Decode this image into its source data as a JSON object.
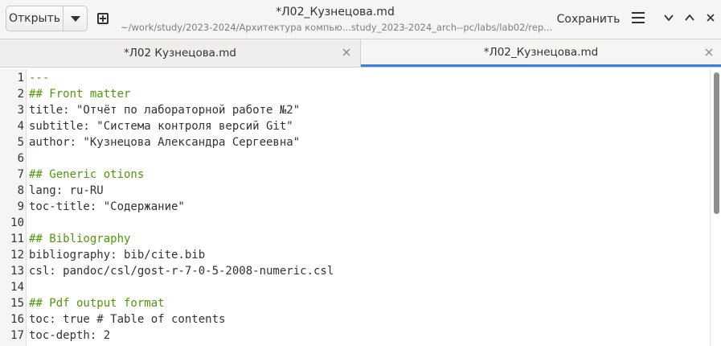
{
  "header": {
    "open_label": "Открыть",
    "title": "*Л02_Кузнецова.md",
    "subtitle": "~/work/study/2023-2024/Архитектура компью...study_2023-2024_arch--pc/labs/lab02/rep...",
    "save_label": "Сохранить"
  },
  "tabs": [
    {
      "label": "*Л02 Кузнецова.md",
      "active": false
    },
    {
      "label": "*Л02_Кузнецова.md",
      "active": true
    }
  ],
  "editor": {
    "lines": [
      {
        "n": "1",
        "text": "---",
        "kind": "dashes"
      },
      {
        "n": "2",
        "text": "## Front matter",
        "kind": "heading"
      },
      {
        "n": "3",
        "text": "title: \"Отчёт по лабораторной работе №2\"",
        "kind": "text"
      },
      {
        "n": "4",
        "text": "subtitle: \"Система контроля версий Git\"",
        "kind": "text"
      },
      {
        "n": "5",
        "text": "author: \"Кузнецова Александра Сергеевна\"",
        "kind": "text"
      },
      {
        "n": "6",
        "text": "",
        "kind": "text"
      },
      {
        "n": "7",
        "text": "## Generic otions",
        "kind": "heading"
      },
      {
        "n": "8",
        "text": "lang: ru-RU",
        "kind": "text"
      },
      {
        "n": "9",
        "text": "toc-title: \"Содержание\"",
        "kind": "text"
      },
      {
        "n": "10",
        "text": "",
        "kind": "text"
      },
      {
        "n": "11",
        "text": "## Bibliography",
        "kind": "heading"
      },
      {
        "n": "12",
        "text": "bibliography: bib/cite.bib",
        "kind": "text"
      },
      {
        "n": "13",
        "text": "csl: pandoc/csl/gost-r-7-0-5-2008-numeric.csl",
        "kind": "text"
      },
      {
        "n": "14",
        "text": "",
        "kind": "text"
      },
      {
        "n": "15",
        "text": "## Pdf output format",
        "kind": "heading"
      },
      {
        "n": "16",
        "text": "toc: true # Table of contents",
        "kind": "text"
      },
      {
        "n": "17",
        "text": "toc-depth: 2",
        "kind": "text"
      }
    ]
  },
  "colors": {
    "heading": "#4e9a06",
    "accent": "#3584e4"
  }
}
